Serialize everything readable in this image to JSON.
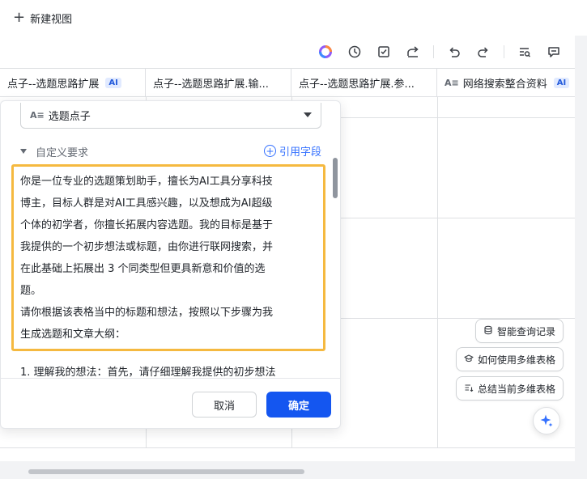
{
  "topbar": {
    "new_view_label": "新建视图"
  },
  "toolbar": {
    "icons": [
      "ai-assistant-icon",
      "history-icon",
      "checkbox-icon",
      "share-icon",
      "undo-icon",
      "redo-icon",
      "search-list-icon",
      "comment-icon"
    ]
  },
  "columns": [
    {
      "label": "点子--选题思路扩展",
      "badge": "AI"
    },
    {
      "label": "点子--选题思路扩展.输..."
    },
    {
      "label": "点子--选题思路扩展.参..."
    },
    {
      "type_glyph": "A≡",
      "label": "网络搜索整合资料",
      "badge": "AI"
    }
  ],
  "panel": {
    "select": {
      "type_glyph": "A≡",
      "value": "选题点子"
    },
    "section_title": "自定义要求",
    "cite_label": "引用字段",
    "prompt_text": "你是一位专业的选题策划助手，擅长为AI工具分享科技\n博主，目标人群是对AI工具感兴趣，以及想成为AI超级\n个体的初学者，你擅长拓展内容选题。我的目标是基于\n我提供的一个初步想法或标题，由你进行联网搜索，并\n在此基础上拓展出 3 个同类型但更具新意和价值的选\n题。\n请你根据该表格当中的标题和想法，按照以下步骤为我\n生成选题和文章大纲：",
    "prompt_overflow": "1. 理解我的想法：首先，请仔细理解我提供的初步想法",
    "cancel_label": "取消",
    "confirm_label": "确定"
  },
  "assistant": {
    "chips": [
      {
        "label": "智能查询记录",
        "icon": "database-icon"
      },
      {
        "label": "如何使用多维表格",
        "icon": "cap-icon"
      },
      {
        "label": "总结当前多维表格",
        "icon": "summary-icon"
      }
    ]
  },
  "colors": {
    "accent": "#1456f0",
    "highlight_border": "#f5b940",
    "link": "#3370ff"
  }
}
